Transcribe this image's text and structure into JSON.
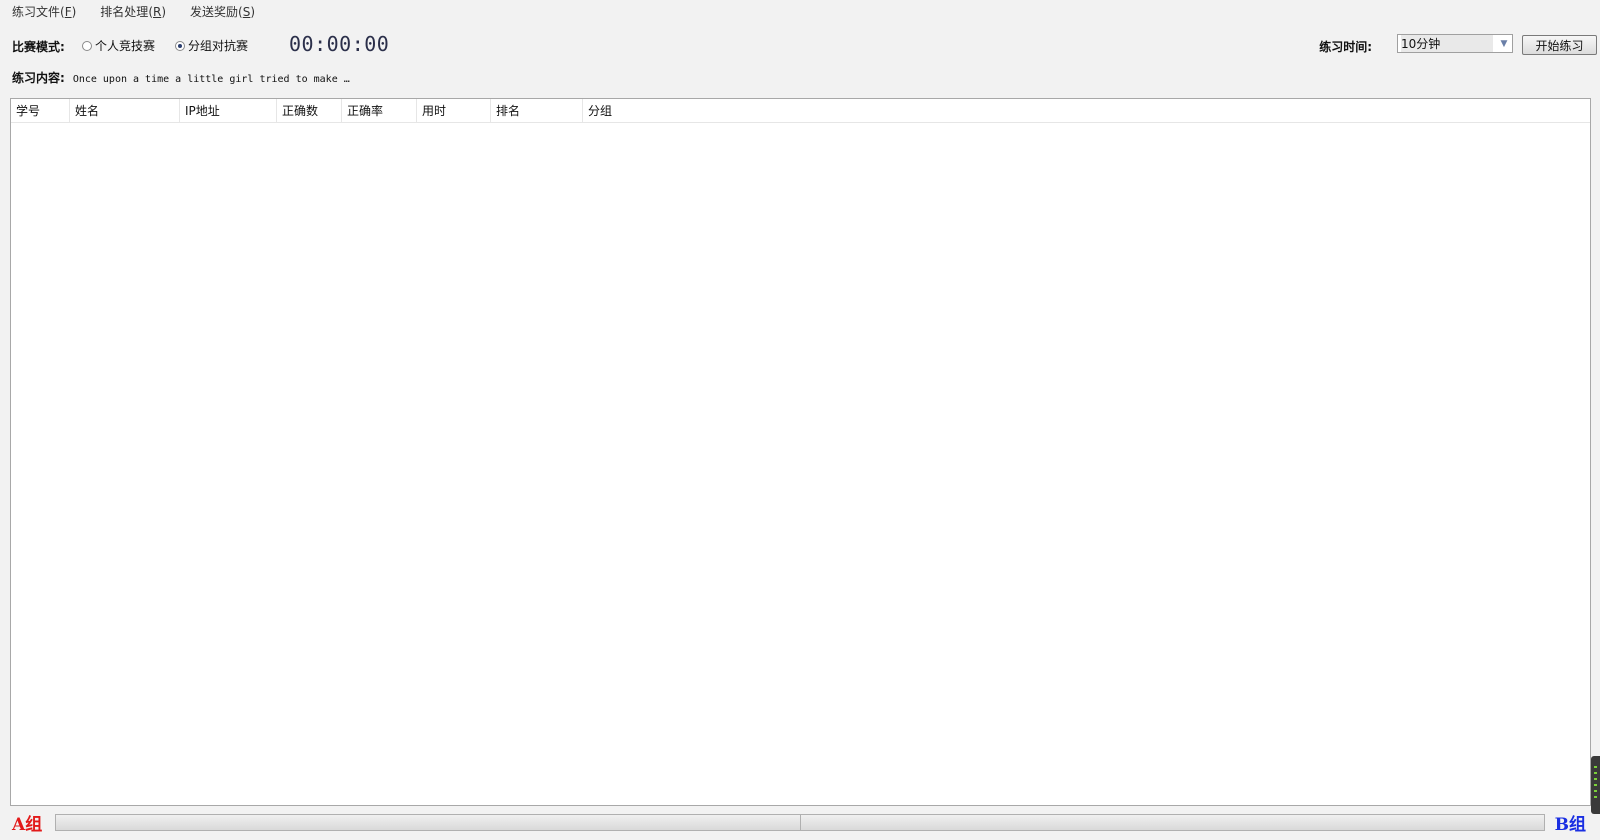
{
  "menu": {
    "items": [
      {
        "label": "练习文件",
        "key": "F"
      },
      {
        "label": "排名处理",
        "key": "R"
      },
      {
        "label": "发送奖励",
        "key": "S"
      }
    ]
  },
  "mode": {
    "label": "比赛模式:",
    "options": [
      "个人竞技赛",
      "分组对抗赛"
    ],
    "selected": "分组对抗赛"
  },
  "timer": {
    "value": "00:00:00"
  },
  "practice_time": {
    "label": "练习时间:",
    "selected": "10分钟"
  },
  "start_button": {
    "label": "开始练习"
  },
  "content": {
    "label": "练习内容:",
    "text": "Once upon a time a little girl tried to make …"
  },
  "table": {
    "columns": [
      "学号",
      "姓名",
      "IP地址",
      "正确数",
      "正确率",
      "用时",
      "排名",
      "分组"
    ],
    "rows": []
  },
  "teams": {
    "a_label": "A组",
    "b_label": "B组",
    "a_color": "#e21a1a",
    "b_color": "#1a2fe2"
  }
}
